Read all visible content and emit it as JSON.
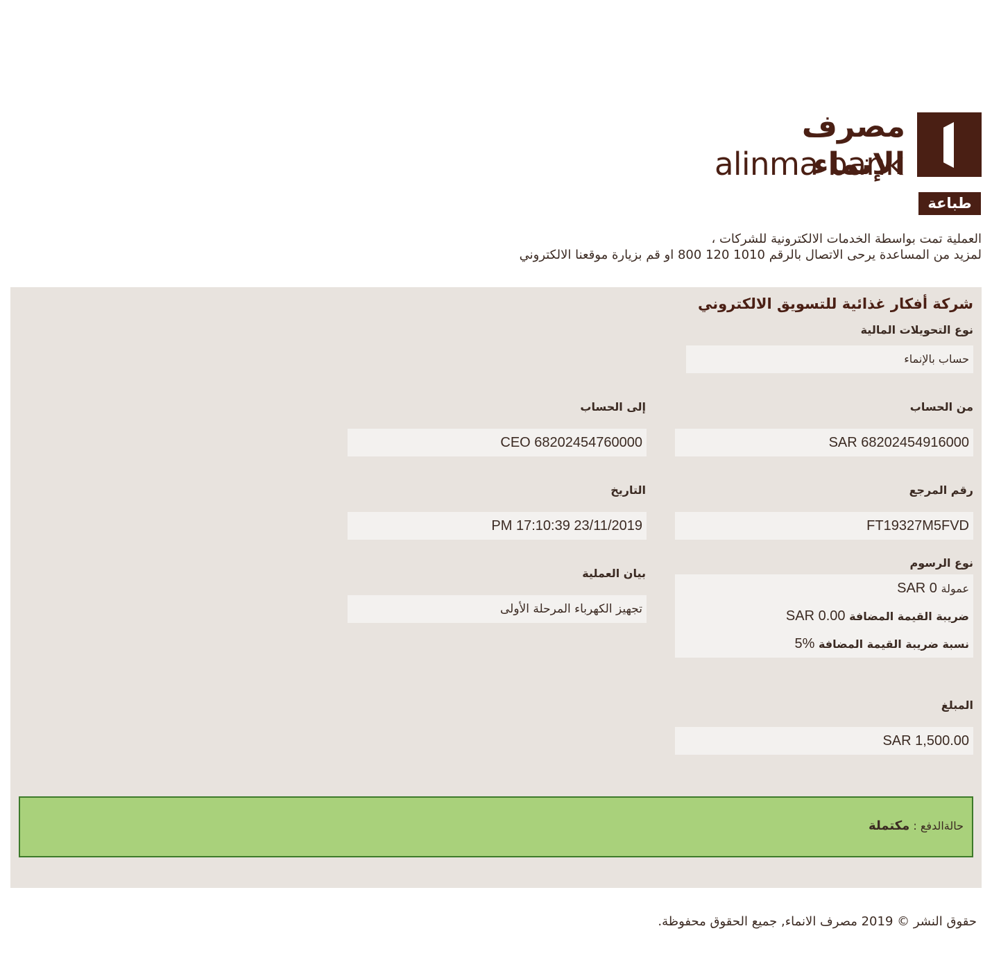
{
  "logo": {
    "arabic_name": "مصرف الإنماء",
    "english_name": "alinma bank"
  },
  "print_label": "طباعة",
  "info": {
    "line1": "العملية تمت بواسطة الخدمات الالكترونية للشركات ،",
    "line2": "لمزيد من المساعدة يرحى الاتصال بالرقم 1010 120 800 او قم بزيارة موقعنا الالكتروني"
  },
  "company_name": "شركة أفكار غذائية للتسويق الالكتروني",
  "transfer_type": {
    "label": "نوع التحويلات المالية",
    "value": "حساب بالإنماء"
  },
  "from_account": {
    "label": "من الحساب",
    "value": "SAR 68202454916000"
  },
  "to_account": {
    "label": "إلى الحساب",
    "value": "CEO 68202454760000"
  },
  "reference": {
    "label": "رقم المرجع",
    "value": "FT19327M5FVD"
  },
  "date": {
    "label": "التاريخ",
    "value": "PM 17:10:39 23/11/2019"
  },
  "fees": {
    "label": "نوع الرسوم",
    "commission_label": "عمولة",
    "commission_value": "SAR 0",
    "vat_label": "ضريبة القيمة المضافة",
    "vat_value": "SAR 0.00",
    "vat_rate_label": "نسبة ضريبة القيمة المضافة",
    "vat_rate_value": "5%"
  },
  "description": {
    "label": "بيان العملية",
    "value": "تجهيز الكهرباء المرحلة الأولى"
  },
  "amount": {
    "label": "المبلغ",
    "value": "SAR 1,500.00"
  },
  "status": {
    "label": "حالةالدفع :",
    "value": "مكتملة"
  },
  "copyright": "حقوق النشر © 2019 مصرف الانماء, جميع الحقوق محفوظة.",
  "colors": {
    "brand": "#4a1f14",
    "panel": "#e8e3de",
    "field": "#f3f1ef",
    "status_bg": "#a9d17b",
    "status_border": "#3d7a2a"
  }
}
